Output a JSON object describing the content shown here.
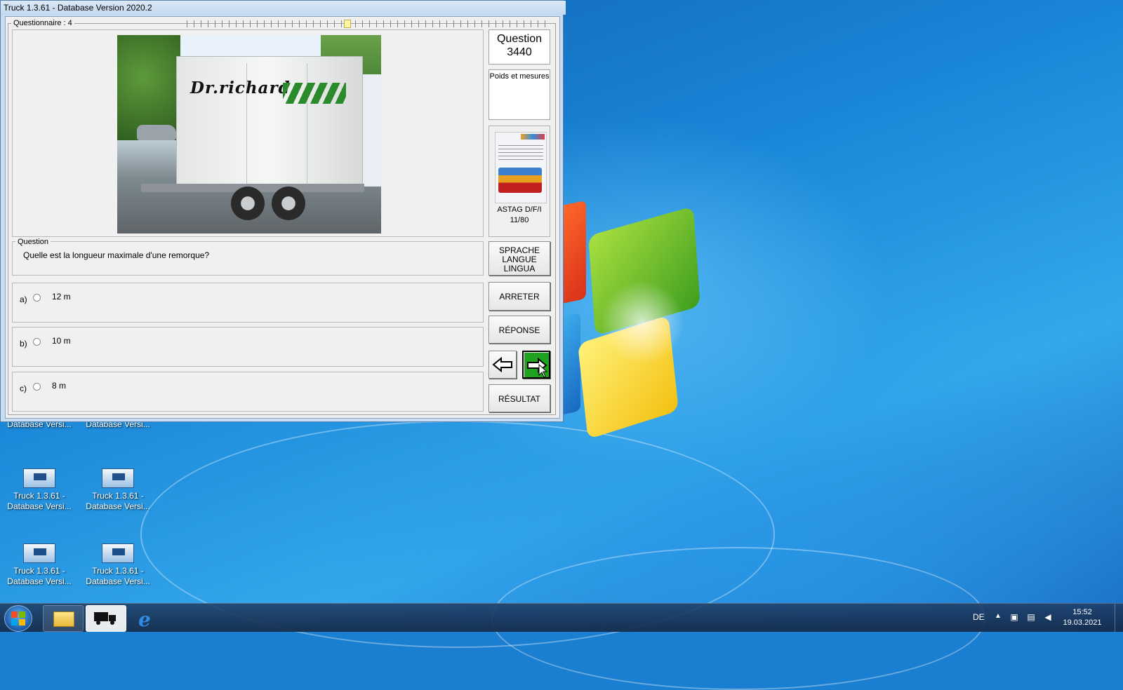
{
  "window": {
    "title": "Truck 1.3.61 - Database Version 2020.2"
  },
  "questionnaire": {
    "legend": "Questionnaire : 4"
  },
  "question": {
    "legend": "Question",
    "text": "Quelle est la longueur maximale d'une remorque?",
    "number_label": "Question",
    "number": "3440",
    "topic": "Poids et mesures"
  },
  "photo": {
    "brand_text": "Dr.richard"
  },
  "answers": [
    {
      "letter": "a)",
      "text": "12 m"
    },
    {
      "letter": "b)",
      "text": "10 m"
    },
    {
      "letter": "c)",
      "text": "8 m"
    }
  ],
  "book": {
    "caption_line1": "ASTAG D/F/I",
    "caption_line2": "11/80"
  },
  "buttons": {
    "language_line1": "SPRACHE",
    "language_line2": "LANGUE",
    "language_line3": "LINGUA",
    "stop": "ARRETER",
    "answer": "RÉPONSE",
    "result": "RÉSULTAT",
    "prev_icon": "arrow-left-icon",
    "next_icon": "arrow-right-icon"
  },
  "desktop": {
    "icons": [
      {
        "line1": "",
        "line2": "Database Versi..."
      },
      {
        "line1": "",
        "line2": "Database Versi..."
      },
      {
        "line1": "Truck 1.3.61 -",
        "line2": "Database Versi..."
      },
      {
        "line1": "Truck 1.3.61 -",
        "line2": "Database Versi..."
      },
      {
        "line1": "Truck 1.3.61 -",
        "line2": "Database Versi..."
      },
      {
        "line1": "Truck 1.3.61 -",
        "line2": "Database Versi..."
      }
    ]
  },
  "taskbar": {
    "language": "DE",
    "time": "15:52",
    "date": "19.03.2021"
  },
  "colors": {
    "next_button": "#1fa31f",
    "window_frame": "#c9ddf2",
    "client_bg": "#f0f0f0"
  }
}
